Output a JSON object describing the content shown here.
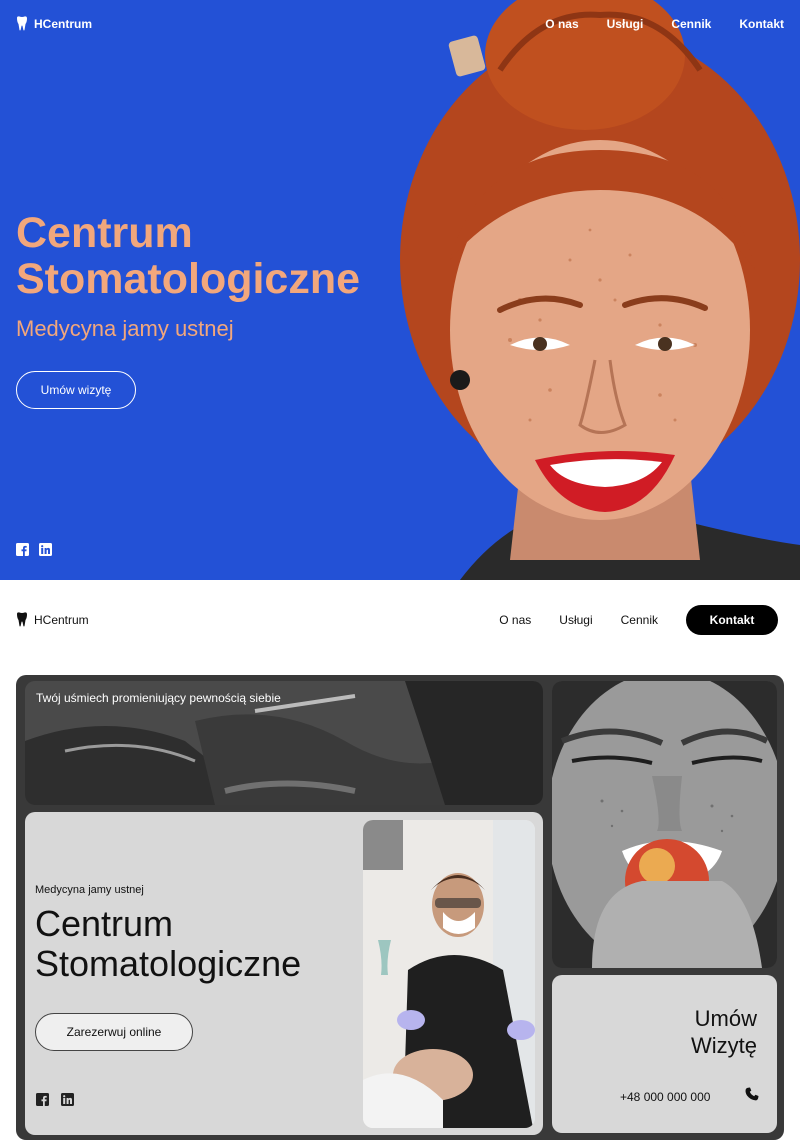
{
  "brand": {
    "name": "HCentrum"
  },
  "hero": {
    "nav": [
      "O nas",
      "Usługi",
      "Cennik",
      "Kontakt"
    ],
    "title_line1": "Centrum",
    "title_line2": "Stomatologiczne",
    "subtitle": "Medycyna jamy ustnej",
    "cta_label": "Umów wizytę",
    "social": [
      "facebook-icon",
      "linkedin-icon"
    ],
    "colors": {
      "background": "#2351d6",
      "accent": "#f2a77c"
    }
  },
  "site2": {
    "nav": [
      "O nas",
      "Usługi",
      "Cennik"
    ],
    "nav_button": "Kontakt",
    "banner_text": "Twój uśmiech promieniujący pewnością siebie",
    "subtitle": "Medycyna jamy ustnej",
    "title_line1": "Centrum",
    "title_line2": "Stomatologiczne",
    "reserve_label": "Zarezerwuj online",
    "cta_line1": "Umów",
    "cta_line2": "Wizytę",
    "phone": "+48 000 000 000",
    "social": [
      "facebook-icon",
      "linkedin-icon"
    ],
    "colors": {
      "frame": "#393939",
      "card": "#d8d8d8",
      "button": "#000000"
    }
  }
}
